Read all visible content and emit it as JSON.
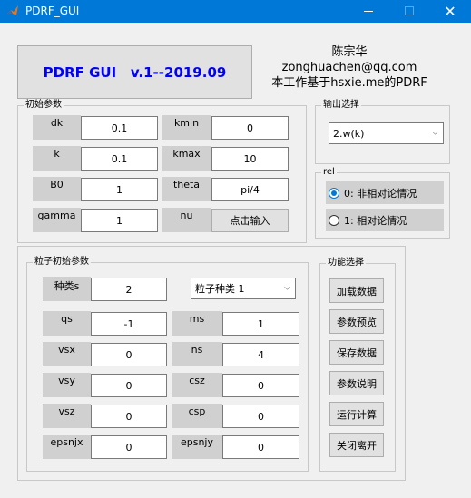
{
  "window": {
    "title": "PDRF_GUI",
    "minimize_icon": "minimize-icon",
    "maximize_icon": "maximize-icon",
    "close_icon": "close-icon",
    "close_glyph": "✕"
  },
  "header": {
    "app_title": "PDRF GUI   v.1--2019.09",
    "author_name": "陈宗华",
    "author_email": "zonghuachen@qq.com",
    "credit": "本工作基于hsxie.me的PDRF"
  },
  "initial_params": {
    "title": "初始参数",
    "rows": [
      {
        "l1": "dk",
        "v1": "0.1",
        "l2": "kmin",
        "v2": "0"
      },
      {
        "l1": "k",
        "v1": "0.1",
        "l2": "kmax",
        "v2": "10"
      },
      {
        "l1": "B0",
        "v1": "1",
        "l2": "theta",
        "v2": "pi/4"
      },
      {
        "l1": "gamma",
        "v1": "1",
        "l2": "nu",
        "v2": "点击输入"
      }
    ]
  },
  "output": {
    "title": "输出选择",
    "selected": "2.w(k)"
  },
  "rel": {
    "title": "rel",
    "options": [
      "0: 非相对论情况",
      "1: 相对论情况"
    ],
    "selected_index": 0
  },
  "species": {
    "title": "粒子初始参数",
    "count_label": "种类s",
    "count_value": "2",
    "species_select": "粒子种类 1",
    "rows": [
      {
        "l1": "qs",
        "v1": "-1",
        "l2": "ms",
        "v2": "1"
      },
      {
        "l1": "vsx",
        "v1": "0",
        "l2": "ns",
        "v2": "4"
      },
      {
        "l1": "vsy",
        "v1": "0",
        "l2": "csz",
        "v2": "0"
      },
      {
        "l1": "vsz",
        "v1": "0",
        "l2": "csp",
        "v2": "0"
      },
      {
        "l1": "epsnjx",
        "v1": "0",
        "l2": "epsnjy",
        "v2": "0"
      }
    ]
  },
  "functions": {
    "title": "功能选择",
    "buttons": [
      "加载数据",
      "参数预览",
      "保存数据",
      "参数说明",
      "运行计算",
      "关闭离开"
    ]
  }
}
